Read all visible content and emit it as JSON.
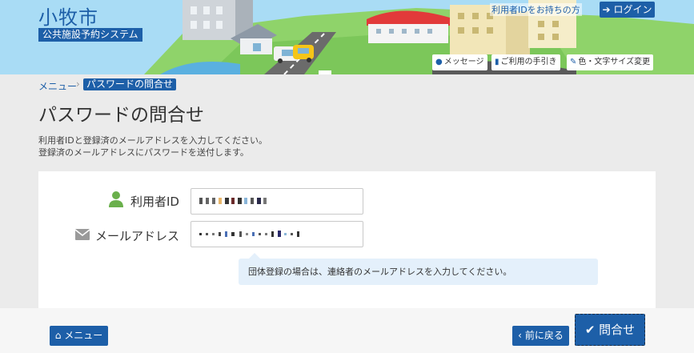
{
  "header": {
    "site_title": "小牧市",
    "site_subtitle": "公共施設予約システム",
    "have_id_text": "利用者IDをお持ちの方",
    "login_label": "ログイン",
    "links": {
      "message": "メッセージ",
      "guide": "ご利用の手引き",
      "display": "色・文字サイズ変更"
    }
  },
  "breadcrumb": {
    "menu": "メニュー",
    "separator": "›",
    "current": "パスワードの問合せ"
  },
  "page": {
    "title": "パスワードの問合せ",
    "description_line1": "利用者IDと登録済のメールアドレスを入力してください。",
    "description_line2": "登録済のメールアドレスにパスワードを送付します。"
  },
  "form": {
    "user_id_label": "利用者ID",
    "email_label": "メールアドレス",
    "user_id_value_masked": true,
    "email_value_masked": true,
    "hint": "団体登録の場合は、連絡者のメールアドレスを入力してください。"
  },
  "footer": {
    "menu_label": "メニュー",
    "back_label": "前に戻る",
    "submit_label": "問合せ"
  },
  "icons": {
    "login": "sign-in-icon",
    "message": "comment-icon",
    "guide": "book-icon",
    "display": "brush-icon",
    "user": "user-icon",
    "mail": "envelope-icon",
    "home": "home-icon",
    "back": "chevron-left-icon",
    "submit": "check-icon"
  },
  "colors": {
    "primary": "#1d5fa8",
    "sky": "#a9dcf5",
    "user_icon": "#6ab04c",
    "hint_bg": "#e4f0fb"
  }
}
